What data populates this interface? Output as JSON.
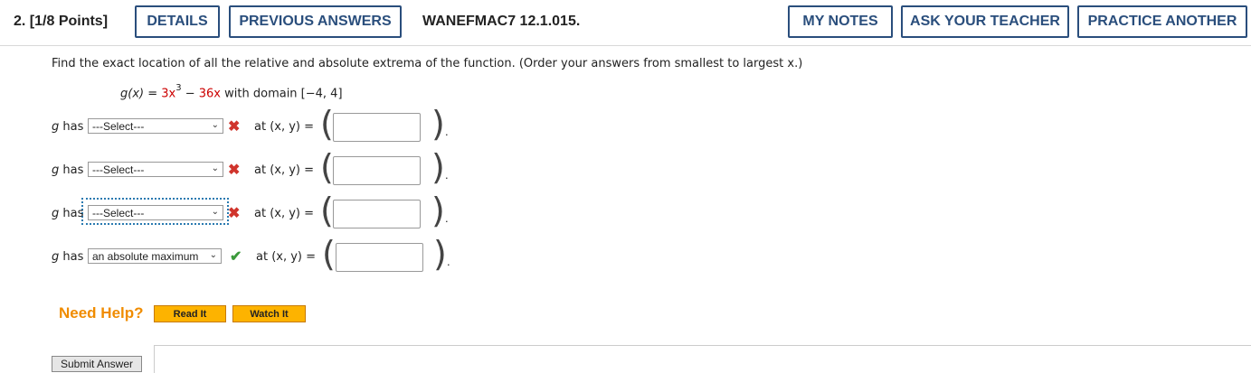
{
  "question": {
    "number": "2.",
    "points": "[1/8 Points]",
    "assignment_code": "WANEFMAC7 12.1.015."
  },
  "toolbar": {
    "details": "DETAILS",
    "previous_answers": "PREVIOUS ANSWERS",
    "my_notes": "MY NOTES",
    "ask_teacher": "ASK YOUR TEACHER",
    "practice_another": "PRACTICE ANOTHER"
  },
  "prompt": "Find the exact location of all the relative and absolute extrema of the function. (Order your answers from smallest to largest x.)",
  "function": {
    "lhs": "g(x) = ",
    "coef1": "3x",
    "exp": "3",
    "minus": " − ",
    "term2": "36x",
    "domain": " with domain [−4, 4]"
  },
  "rows": [
    {
      "g_has": "has",
      "select": "---Select---",
      "status": "incorrect",
      "at": "at (x, y) =",
      "value": ""
    },
    {
      "g_has": "has",
      "select": "---Select---",
      "status": "incorrect",
      "at": "at (x, y) =",
      "value": ""
    },
    {
      "g_has": "has",
      "select": "---Select---",
      "status": "incorrect",
      "at": "at (x, y) =",
      "value": ""
    },
    {
      "g_has": "has",
      "select": "an absolute maximum",
      "status": "correct",
      "at": "at (x, y) =",
      "value": ""
    }
  ],
  "help": {
    "label": "Need Help?",
    "read_it": "Read It",
    "watch_it": "Watch It"
  },
  "submit_label": "Submit Answer",
  "colors": {
    "nav_blue": "#2a4e7c",
    "incorrect_red": "#d0342c",
    "correct_green": "#3c9a3c",
    "help_orange": "#f08c00",
    "button_gold": "#fdb300"
  }
}
